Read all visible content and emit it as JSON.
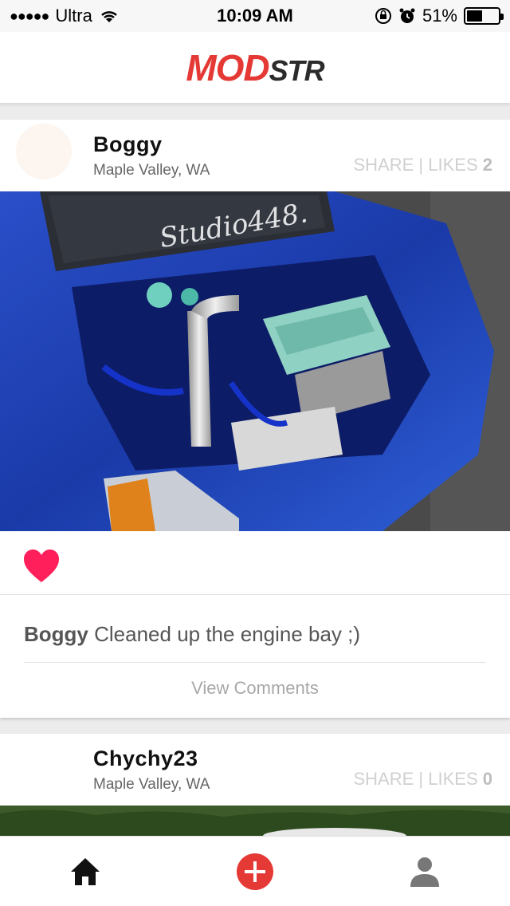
{
  "status_bar": {
    "carrier": "Ultra",
    "time": "10:09 AM",
    "battery": "51%",
    "battery_level": 0.51
  },
  "header": {
    "logo_part1": "MOD",
    "logo_part2": "STR",
    "brand_color": "#e53935"
  },
  "posts": [
    {
      "username": "Boggy",
      "location": "Maple Valley, WA",
      "share_label": "SHARE",
      "separator": " | ",
      "likes_label": "LIKES",
      "likes_count": "2",
      "image_text": "Studio448.",
      "liked": true,
      "caption_user": "Boggy",
      "caption_text": " Cleaned up the engine bay ;)",
      "view_comments": "View Comments"
    },
    {
      "username": "Chychy23",
      "location": "Maple Valley, WA",
      "share_label": "SHARE",
      "separator": " | ",
      "likes_label": "LIKES",
      "likes_count": "0"
    }
  ],
  "tab_bar": {
    "icons": [
      "home-icon",
      "add-post-icon",
      "profile-icon"
    ],
    "accent": "#e53935"
  }
}
